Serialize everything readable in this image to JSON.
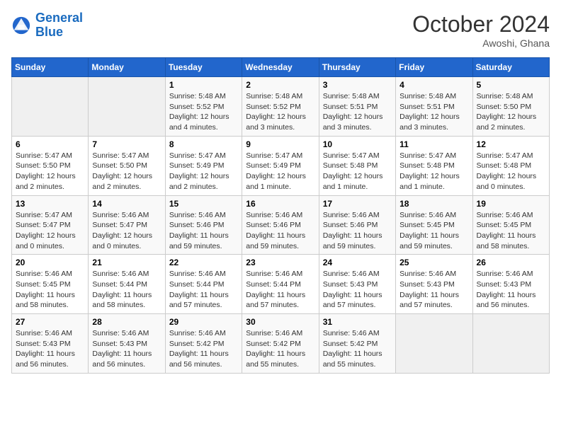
{
  "logo": {
    "line1": "General",
    "line2": "Blue"
  },
  "title": "October 2024",
  "location": "Awoshi, Ghana",
  "weekdays": [
    "Sunday",
    "Monday",
    "Tuesday",
    "Wednesday",
    "Thursday",
    "Friday",
    "Saturday"
  ],
  "weeks": [
    [
      {
        "day": "",
        "info": ""
      },
      {
        "day": "",
        "info": ""
      },
      {
        "day": "1",
        "info": "Sunrise: 5:48 AM\nSunset: 5:52 PM\nDaylight: 12 hours and 4 minutes."
      },
      {
        "day": "2",
        "info": "Sunrise: 5:48 AM\nSunset: 5:52 PM\nDaylight: 12 hours and 3 minutes."
      },
      {
        "day": "3",
        "info": "Sunrise: 5:48 AM\nSunset: 5:51 PM\nDaylight: 12 hours and 3 minutes."
      },
      {
        "day": "4",
        "info": "Sunrise: 5:48 AM\nSunset: 5:51 PM\nDaylight: 12 hours and 3 minutes."
      },
      {
        "day": "5",
        "info": "Sunrise: 5:48 AM\nSunset: 5:50 PM\nDaylight: 12 hours and 2 minutes."
      }
    ],
    [
      {
        "day": "6",
        "info": "Sunrise: 5:47 AM\nSunset: 5:50 PM\nDaylight: 12 hours and 2 minutes."
      },
      {
        "day": "7",
        "info": "Sunrise: 5:47 AM\nSunset: 5:50 PM\nDaylight: 12 hours and 2 minutes."
      },
      {
        "day": "8",
        "info": "Sunrise: 5:47 AM\nSunset: 5:49 PM\nDaylight: 12 hours and 2 minutes."
      },
      {
        "day": "9",
        "info": "Sunrise: 5:47 AM\nSunset: 5:49 PM\nDaylight: 12 hours and 1 minute."
      },
      {
        "day": "10",
        "info": "Sunrise: 5:47 AM\nSunset: 5:48 PM\nDaylight: 12 hours and 1 minute."
      },
      {
        "day": "11",
        "info": "Sunrise: 5:47 AM\nSunset: 5:48 PM\nDaylight: 12 hours and 1 minute."
      },
      {
        "day": "12",
        "info": "Sunrise: 5:47 AM\nSunset: 5:48 PM\nDaylight: 12 hours and 0 minutes."
      }
    ],
    [
      {
        "day": "13",
        "info": "Sunrise: 5:47 AM\nSunset: 5:47 PM\nDaylight: 12 hours and 0 minutes."
      },
      {
        "day": "14",
        "info": "Sunrise: 5:46 AM\nSunset: 5:47 PM\nDaylight: 12 hours and 0 minutes."
      },
      {
        "day": "15",
        "info": "Sunrise: 5:46 AM\nSunset: 5:46 PM\nDaylight: 11 hours and 59 minutes."
      },
      {
        "day": "16",
        "info": "Sunrise: 5:46 AM\nSunset: 5:46 PM\nDaylight: 11 hours and 59 minutes."
      },
      {
        "day": "17",
        "info": "Sunrise: 5:46 AM\nSunset: 5:46 PM\nDaylight: 11 hours and 59 minutes."
      },
      {
        "day": "18",
        "info": "Sunrise: 5:46 AM\nSunset: 5:45 PM\nDaylight: 11 hours and 59 minutes."
      },
      {
        "day": "19",
        "info": "Sunrise: 5:46 AM\nSunset: 5:45 PM\nDaylight: 11 hours and 58 minutes."
      }
    ],
    [
      {
        "day": "20",
        "info": "Sunrise: 5:46 AM\nSunset: 5:45 PM\nDaylight: 11 hours and 58 minutes."
      },
      {
        "day": "21",
        "info": "Sunrise: 5:46 AM\nSunset: 5:44 PM\nDaylight: 11 hours and 58 minutes."
      },
      {
        "day": "22",
        "info": "Sunrise: 5:46 AM\nSunset: 5:44 PM\nDaylight: 11 hours and 57 minutes."
      },
      {
        "day": "23",
        "info": "Sunrise: 5:46 AM\nSunset: 5:44 PM\nDaylight: 11 hours and 57 minutes."
      },
      {
        "day": "24",
        "info": "Sunrise: 5:46 AM\nSunset: 5:43 PM\nDaylight: 11 hours and 57 minutes."
      },
      {
        "day": "25",
        "info": "Sunrise: 5:46 AM\nSunset: 5:43 PM\nDaylight: 11 hours and 57 minutes."
      },
      {
        "day": "26",
        "info": "Sunrise: 5:46 AM\nSunset: 5:43 PM\nDaylight: 11 hours and 56 minutes."
      }
    ],
    [
      {
        "day": "27",
        "info": "Sunrise: 5:46 AM\nSunset: 5:43 PM\nDaylight: 11 hours and 56 minutes."
      },
      {
        "day": "28",
        "info": "Sunrise: 5:46 AM\nSunset: 5:43 PM\nDaylight: 11 hours and 56 minutes."
      },
      {
        "day": "29",
        "info": "Sunrise: 5:46 AM\nSunset: 5:42 PM\nDaylight: 11 hours and 56 minutes."
      },
      {
        "day": "30",
        "info": "Sunrise: 5:46 AM\nSunset: 5:42 PM\nDaylight: 11 hours and 55 minutes."
      },
      {
        "day": "31",
        "info": "Sunrise: 5:46 AM\nSunset: 5:42 PM\nDaylight: 11 hours and 55 minutes."
      },
      {
        "day": "",
        "info": ""
      },
      {
        "day": "",
        "info": ""
      }
    ]
  ]
}
